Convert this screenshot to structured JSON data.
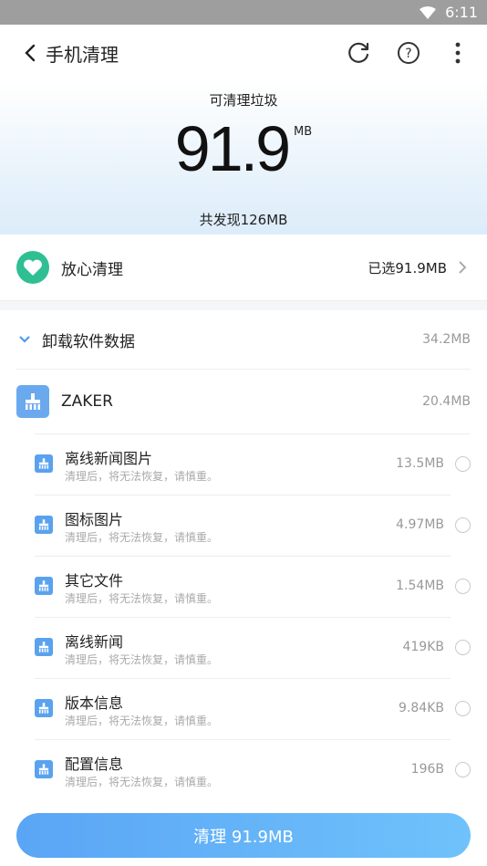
{
  "status_bar": {
    "time": "6:11",
    "icons": [
      "wifi-icon",
      "battery-icon"
    ]
  },
  "header": {
    "title": "手机清理",
    "actions": [
      "refresh-icon",
      "help-icon",
      "more-icon"
    ]
  },
  "hero": {
    "label": "可清理垃圾",
    "amount": "91.9",
    "unit": "MB",
    "found": "共发现126MB"
  },
  "safe_clean": {
    "label": "放心清理",
    "selected": "已选91.9MB"
  },
  "group": {
    "label": "卸载软件数据",
    "size": "34.2MB"
  },
  "app": {
    "name": "ZAKER",
    "size": "20.4MB"
  },
  "items": [
    {
      "title": "离线新闻图片",
      "subtitle": "清理后，将无法恢复，请慎重。",
      "size": "13.5MB"
    },
    {
      "title": "图标图片",
      "subtitle": "清理后，将无法恢复，请慎重。",
      "size": "4.97MB"
    },
    {
      "title": "其它文件",
      "subtitle": "清理后，将无法恢复，请慎重。",
      "size": "1.54MB"
    },
    {
      "title": "离线新闻",
      "subtitle": "清理后，将无法恢复，请慎重。",
      "size": "419KB"
    },
    {
      "title": "版本信息",
      "subtitle": "清理后，将无法恢复，请慎重。",
      "size": "9.84KB"
    },
    {
      "title": "配置信息",
      "subtitle": "清理后，将无法恢复，请慎重。",
      "size": "196B"
    }
  ],
  "clean_button": {
    "label": "清理 91.9MB"
  },
  "colors": {
    "accent": "#5aa5f5",
    "safe_green": "#2fbf93",
    "app_icon": "#6ba9ef"
  }
}
